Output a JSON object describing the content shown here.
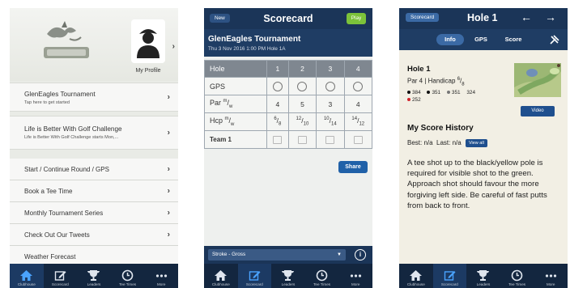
{
  "screen1": {
    "profile_label": "My Profile",
    "cards": [
      {
        "title": "GlenEagles Tournament",
        "subtitle": "Tap here to get started"
      },
      {
        "title": "Life is Better With Golf Challenge",
        "subtitle": "Life is Better With Golf Challenge starts Mon,..."
      }
    ],
    "menu": [
      "Start / Continue Round / GPS",
      "Book a Tee Time",
      "Monthly Tournament Series",
      "Check Out Our Tweets",
      "Weather Forecast"
    ],
    "tabs": [
      "Clubhouse",
      "Scorecard",
      "Leaders",
      "Tee Times",
      "More"
    ]
  },
  "screen2": {
    "new_label": "New",
    "title": "Scorecard",
    "play_label": "Play",
    "tournament": "GlenEagles Tournament",
    "date_line": "Thu 3 Nov 2016 1:00 PM Hole 1A",
    "table": {
      "hole_label": "Hole",
      "holes": [
        "1",
        "2",
        "3",
        "4"
      ],
      "gps_label": "GPS",
      "par_label": "Par",
      "par_sup": "m",
      "par_sub": "w",
      "pars": [
        "4",
        "5",
        "3",
        "4"
      ],
      "hcp_label": "Hcp",
      "hcp_sup": "m",
      "hcp_sub": "w",
      "hcp": [
        {
          "m": "6",
          "w": "8"
        },
        {
          "m": "12",
          "w": "10"
        },
        {
          "m": "10",
          "w": "14"
        },
        {
          "m": "14",
          "w": "12"
        }
      ],
      "team_label": "Team 1"
    },
    "share_label": "Share",
    "stroke_label": "Stroke - Gross",
    "info_glyph": "i",
    "tabs": [
      "Clubhouse",
      "Scorecard",
      "Leaders",
      "Tee Times",
      "More"
    ]
  },
  "screen3": {
    "scorecard_label": "Scorecard",
    "title": "Hole 1",
    "segments": [
      "Info",
      "GPS",
      "Score"
    ],
    "hole_title": "Hole 1",
    "par_text": "Par 4 | Handicap",
    "hcp_m": "6",
    "hcp_w": "8",
    "yardages": [
      {
        "value": "384",
        "color": "#111111"
      },
      {
        "value": "351",
        "color": "#111111"
      },
      {
        "value": "351",
        "color": "#777777"
      },
      {
        "value": "324",
        "color": null
      },
      {
        "value": "252",
        "color": "#d0232a"
      }
    ],
    "video_label": "Video",
    "history_title": "My Score History",
    "best_text": "Best: n/a",
    "last_text": "Last: n/a",
    "view_all_label": "View all",
    "description": "A tee shot up to the black/yellow pole is required for visible shot to the green. Approach shot should favour the more forgiving left side. Be careful of fast putts from back to front.",
    "tabs": [
      "Clubhouse",
      "Scorecard",
      "Leaders",
      "Tee Times",
      "More"
    ],
    "active_tab": 1
  },
  "colors": {
    "navy": "#1b3558",
    "play_green": "#7cc23a",
    "button_blue": "#2061a8"
  }
}
